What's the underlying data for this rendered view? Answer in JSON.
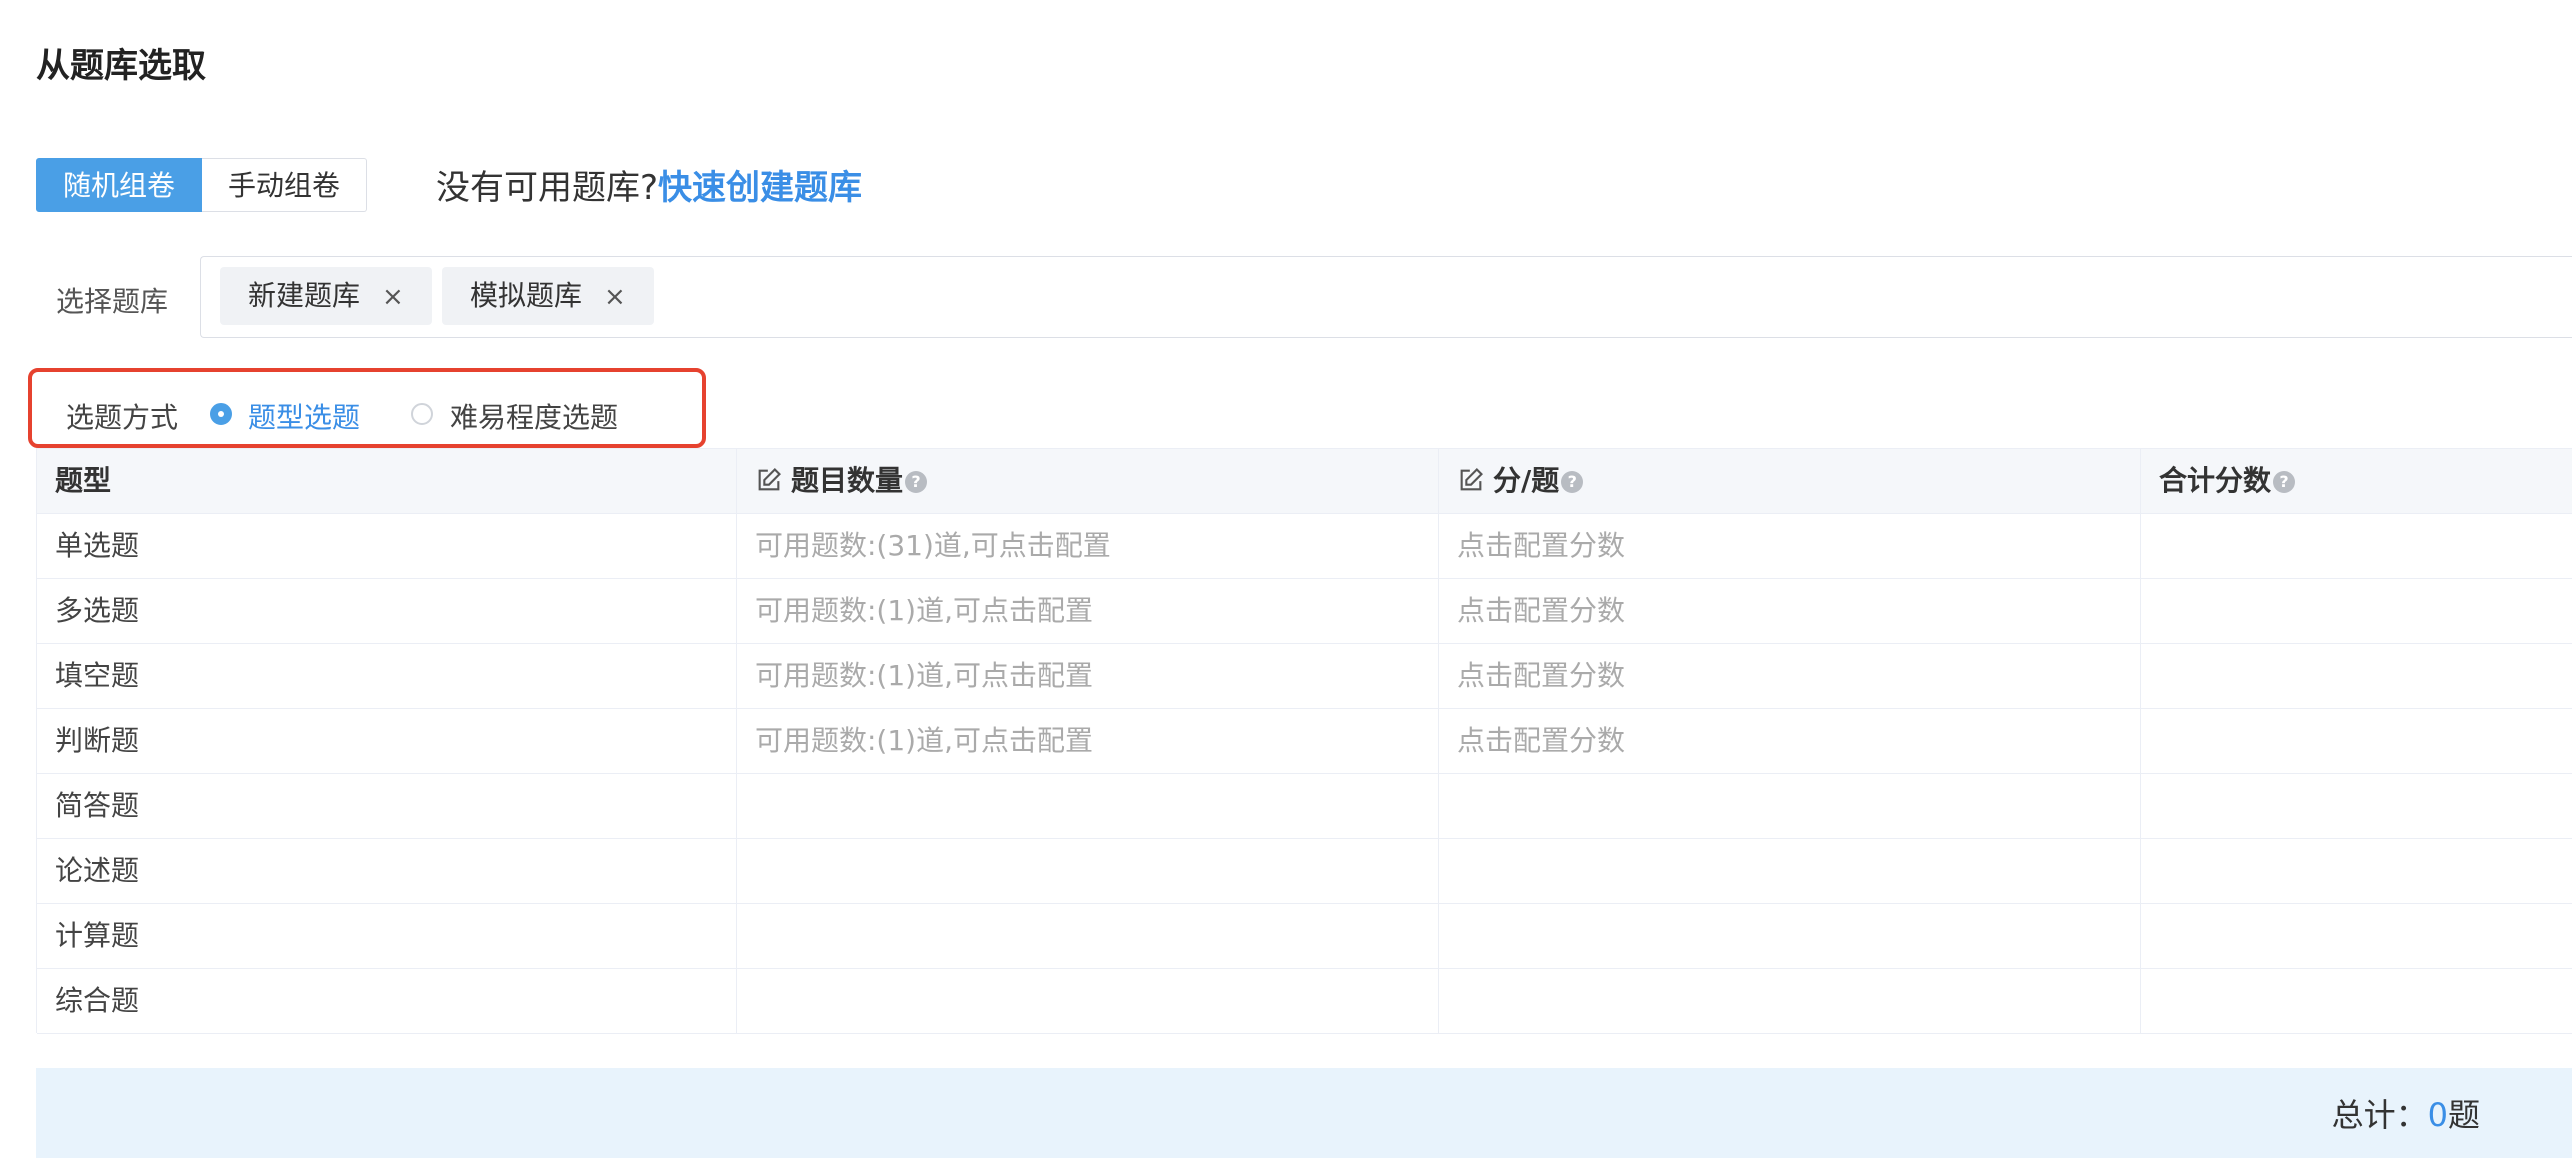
{
  "page": {
    "title": "从题库选取"
  },
  "mode_tabs": [
    {
      "label": "随机组卷",
      "active": true
    },
    {
      "label": "手动组卷",
      "active": false
    }
  ],
  "hint": {
    "text": "没有可用题库?",
    "link": "快速创建题库"
  },
  "bank_select": {
    "label": "选择题库",
    "tags": [
      {
        "label": "新建题库",
        "remove": "×"
      },
      {
        "label": "模拟题库",
        "remove": "×"
      }
    ]
  },
  "method": {
    "label": "选题方式",
    "options": [
      {
        "label": "题型选题",
        "selected": true
      },
      {
        "label": "难易程度选题",
        "selected": false
      }
    ]
  },
  "table": {
    "headers": {
      "type": "题型",
      "count": "题目数量",
      "score": "分/题",
      "total": "合计分数",
      "help_icon": "?"
    },
    "rows": [
      {
        "type": "单选题",
        "count": "可用题数:(31)道,可点击配置",
        "score": "点击配置分数",
        "total": ""
      },
      {
        "type": "多选题",
        "count": "可用题数:(1)道,可点击配置",
        "score": "点击配置分数",
        "total": ""
      },
      {
        "type": "填空题",
        "count": "可用题数:(1)道,可点击配置",
        "score": "点击配置分数",
        "total": ""
      },
      {
        "type": "判断题",
        "count": "可用题数:(1)道,可点击配置",
        "score": "点击配置分数",
        "total": ""
      },
      {
        "type": "简答题",
        "count": "",
        "score": "",
        "total": ""
      },
      {
        "type": "论述题",
        "count": "",
        "score": "",
        "total": ""
      },
      {
        "type": "计算题",
        "count": "",
        "score": "",
        "total": ""
      },
      {
        "type": "综合题",
        "count": "",
        "score": "",
        "total": ""
      }
    ]
  },
  "footer": {
    "prefix": "总计：",
    "count": "0",
    "suffix": "题"
  },
  "colors": {
    "primary": "#4a9fe6",
    "link": "#3a8ee6",
    "highlight_frame": "#e6422f",
    "footer_bg": "#e8f3fc"
  }
}
